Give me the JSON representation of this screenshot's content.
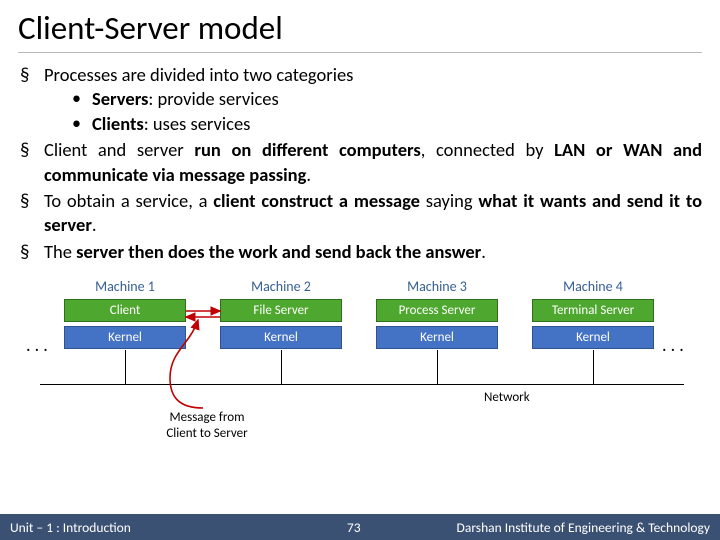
{
  "title": "Client-Server model",
  "bullets": {
    "b1": "Processes are divided into two categories",
    "s1_label": "Servers",
    "s1_rest": ": provide services",
    "s2_label": "Clients",
    "s2_rest": ": uses services",
    "b2_pre": "Client and server ",
    "b2_bold1": "run on different computers",
    "b2_mid": ", connected by ",
    "b2_bold2": "LAN or WAN and communicate via message passing",
    "b2_post": ".",
    "b3_pre": "To obtain a service, a ",
    "b3_bold1": "client construct a message",
    "b3_mid": " saying ",
    "b3_bold2": "what it wants and send it to server",
    "b3_post": ".",
    "b4_pre": "The ",
    "b4_bold": "server then does the work and send back the answer",
    "b4_post": "."
  },
  "diagram": {
    "dots": ". . .",
    "m1": "Machine 1",
    "m2": "Machine 2",
    "m3": "Machine 3",
    "m4": "Machine 4",
    "c1": "Client",
    "c2": "File Server",
    "c3": "Process Server",
    "c4": "Terminal Server",
    "kernel": "Kernel",
    "network": "Network",
    "msg": "Message from\nClient to Server",
    "msg_l1": "Message from",
    "msg_l2": "Client to Server"
  },
  "footer": {
    "unit": "Unit – 1 : Introduction",
    "page": "73",
    "inst": "Darshan Institute of Engineering & Technology"
  }
}
